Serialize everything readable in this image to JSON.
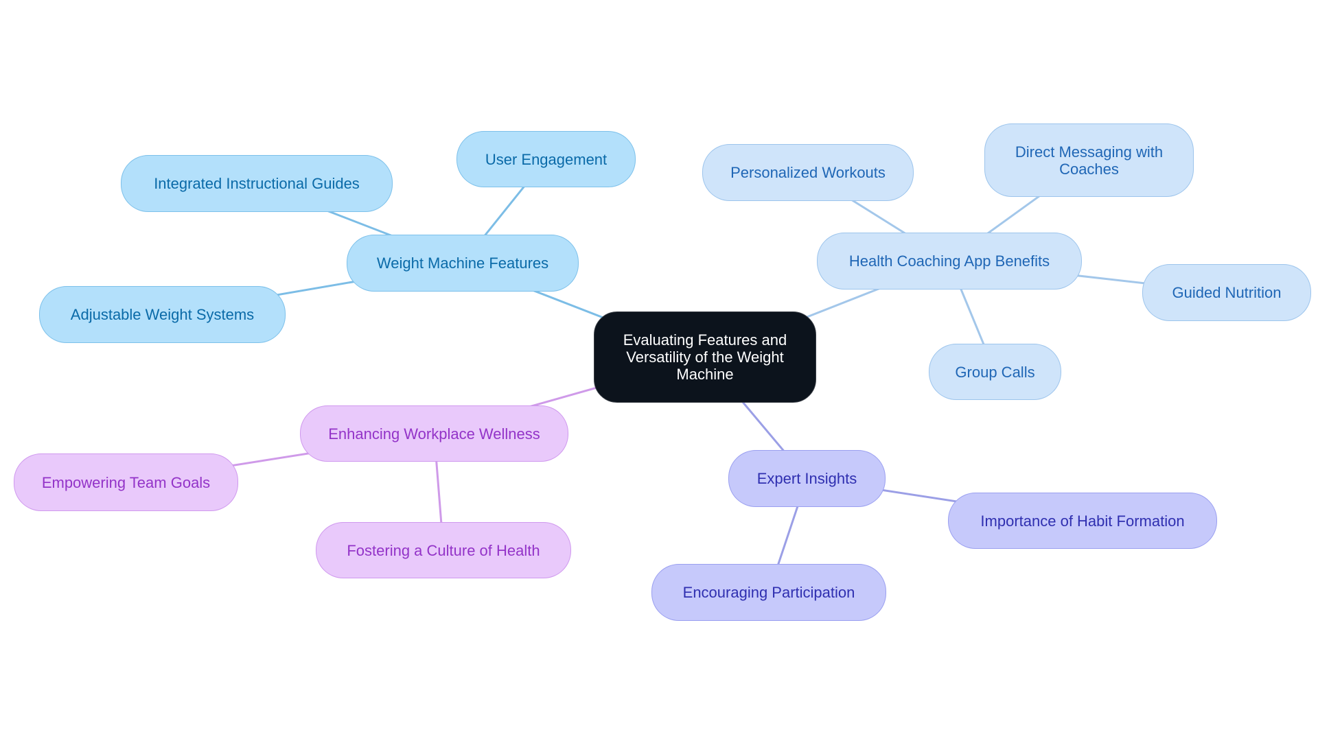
{
  "diagram": {
    "type": "mindmap",
    "root": {
      "id": "root",
      "label": "Evaluating Features and Versatility of the Weight Machine"
    },
    "branches": [
      {
        "id": "wmf",
        "label": "Weight Machine Features",
        "theme": "blue1",
        "color": "#7cbde6",
        "children": [
          {
            "id": "ue",
            "label": "User Engagement"
          },
          {
            "id": "iig",
            "label": "Integrated Instructional Guides"
          },
          {
            "id": "aws",
            "label": "Adjustable Weight Systems"
          }
        ]
      },
      {
        "id": "hcab",
        "label": "Health Coaching App Benefits",
        "theme": "blue2",
        "color": "#a3c7ea",
        "children": [
          {
            "id": "pw",
            "label": "Personalized Workouts"
          },
          {
            "id": "dmc",
            "label": "Direct Messaging with Coaches"
          },
          {
            "id": "gn",
            "label": "Guided Nutrition"
          },
          {
            "id": "gc",
            "label": "Group Calls"
          }
        ]
      },
      {
        "id": "eww",
        "label": "Enhancing Workplace Wellness",
        "theme": "purple",
        "color": "#cf9ae9",
        "children": [
          {
            "id": "etg",
            "label": "Empowering Team Goals"
          },
          {
            "id": "fch",
            "label": "Fostering a Culture of Health"
          }
        ]
      },
      {
        "id": "ei",
        "label": "Expert Insights",
        "theme": "indigo",
        "color": "#9b9fe6",
        "children": [
          {
            "id": "ihf",
            "label": "Importance of Habit Formation"
          },
          {
            "id": "ep",
            "label": "Encouraging Participation"
          }
        ]
      }
    ]
  }
}
